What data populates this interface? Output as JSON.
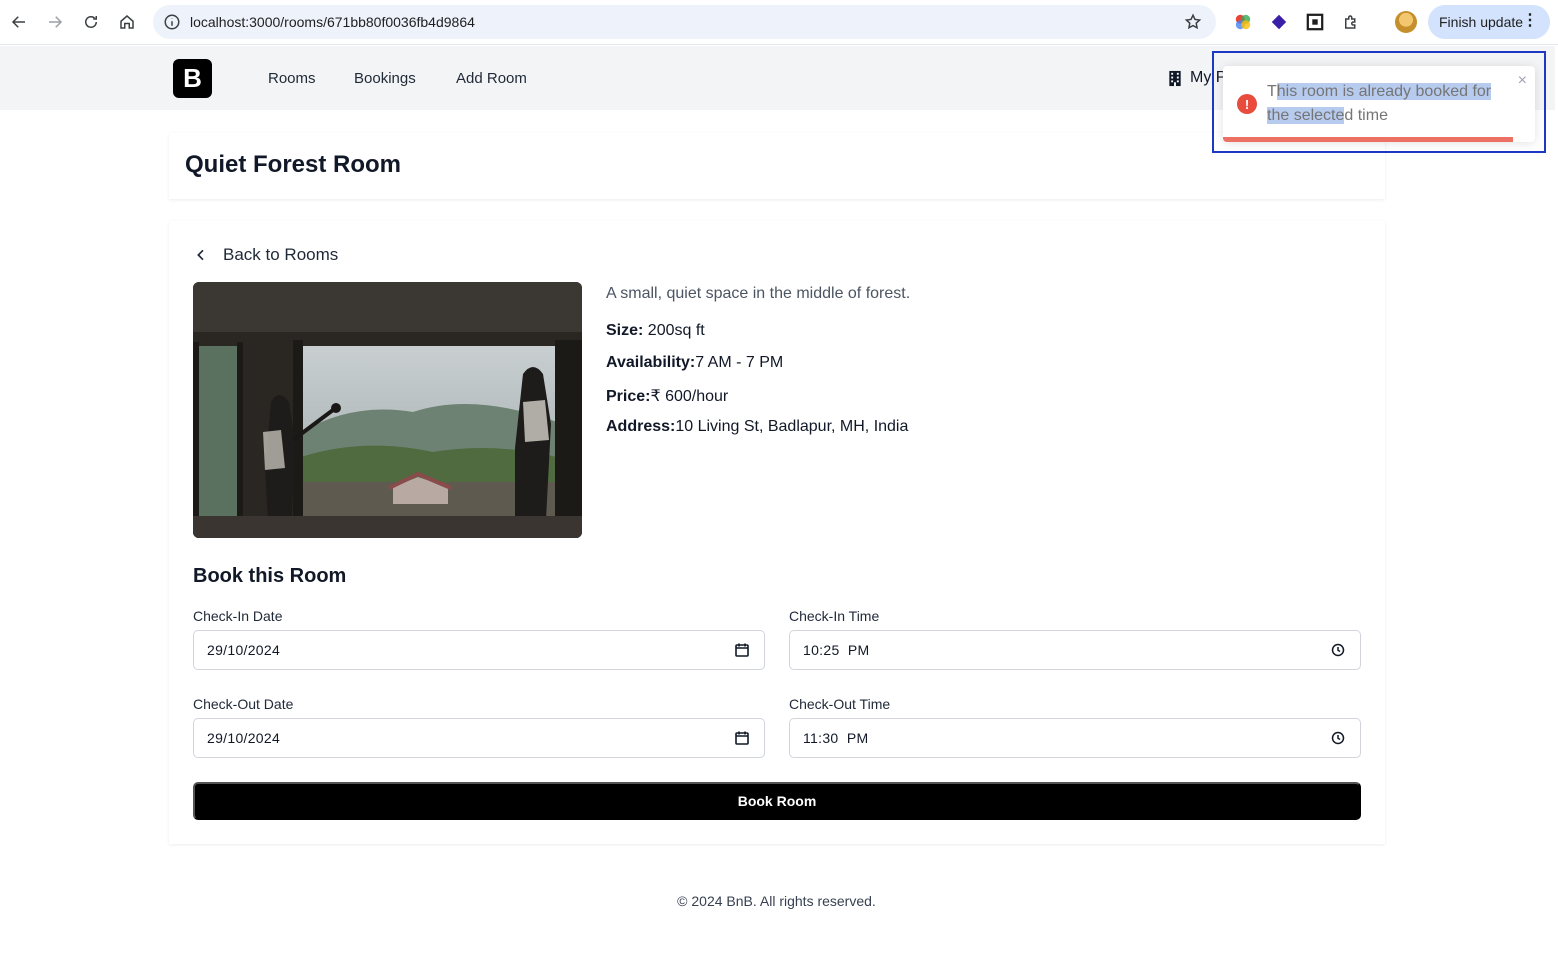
{
  "browser": {
    "url": "localhost:3000/rooms/671bb80f0036fb4d9864",
    "finish_update": "Finish update",
    "extensions": [
      "color-wheel-icon",
      "diamond-extension-icon",
      "frame-extension-icon",
      "puzzle-extensions-icon"
    ]
  },
  "header": {
    "logo": "B",
    "nav": [
      "Rooms",
      "Bookings",
      "Add Room"
    ],
    "my_properties": "My P"
  },
  "room": {
    "title": "Quiet Forest Room",
    "back_label": "Back to Rooms",
    "description": "A small, quiet space in the middle of forest.",
    "size_label": "Size:",
    "size_value": " 200sq ft",
    "availability_label": "Availability:",
    "availability_value": "7 AM - 7 PM",
    "price_label": "Price:",
    "price_value": "₹ 600/hour",
    "address_label": "Address:",
    "address_value": "10 Living St, Badlapur, MH, India"
  },
  "booking": {
    "title": "Book this Room",
    "checkin_date_label": "Check-In Date",
    "checkin_date": "29/10/2024",
    "checkin_time_label": "Check-In Time",
    "checkin_time": "10:25  PM",
    "checkout_date_label": "Check-Out Date",
    "checkout_date": "29/10/2024",
    "checkout_time_label": "Check-Out Time",
    "checkout_time": "11:30  PM",
    "submit_label": "Book Room"
  },
  "toast": {
    "message_prefix": "T",
    "message_highlight": "his room is already booked for the selecte",
    "message_suffix": "d time",
    "close": "×",
    "progress": 0.93,
    "status_color": "#e74c3c"
  },
  "footer": {
    "text": "© 2024 BnB. All rights reserved."
  }
}
